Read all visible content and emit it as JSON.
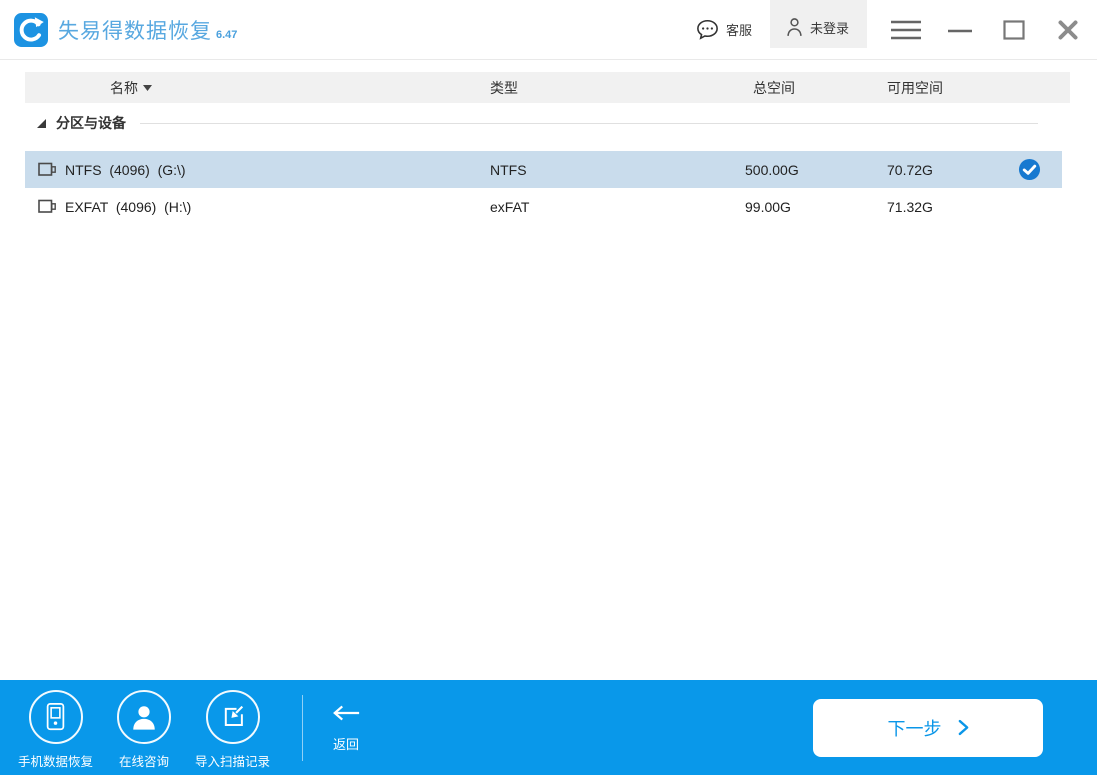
{
  "window": {
    "title": "失易得数据恢复",
    "version": "6.47"
  },
  "titlebar": {
    "kefu_label": "客服",
    "login_label": "未登录"
  },
  "table": {
    "columns": [
      "名称",
      "类型",
      "总空间",
      "可用空间"
    ],
    "section_label": "分区与设备",
    "rows": [
      {
        "name": "NTFS  (4096)  (G:\\)",
        "type": "NTFS",
        "total": "500.00G",
        "free": "70.72G",
        "selected": true
      },
      {
        "name": "EXFAT  (4096)  (H:\\)",
        "type": "exFAT",
        "total": "99.00G",
        "free": "71.32G",
        "selected": false
      }
    ]
  },
  "footer": {
    "actions": [
      {
        "label": "手机数据恢复",
        "icon": "phone-icon"
      },
      {
        "label": "在线咨询",
        "icon": "person-icon"
      },
      {
        "label": "导入扫描记录",
        "icon": "import-icon"
      }
    ],
    "back_label": "返回",
    "next_label": "下一步"
  },
  "icons": [
    "app-logo-recovery-icon",
    "chat-bubble-icon",
    "user-icon",
    "menu-icon",
    "minimize-icon",
    "maximize-icon",
    "close-icon",
    "sort-arrow-icon",
    "tree-expanded-icon",
    "drive-icon",
    "check-circle-icon",
    "phone-icon",
    "person-icon",
    "import-icon",
    "back-arrow-icon",
    "next-chevron-icon"
  ],
  "colors": {
    "footer_blue": "#0998ea",
    "title_blue": "#58a8e0",
    "logo_blue": "#1d93e2",
    "selected_row": "#c9dcec",
    "check_blue": "#1779d0",
    "next_text_blue": "#0a96e8",
    "header_gray": "#f1f1f1",
    "login_gray": "#f0f0f0"
  }
}
